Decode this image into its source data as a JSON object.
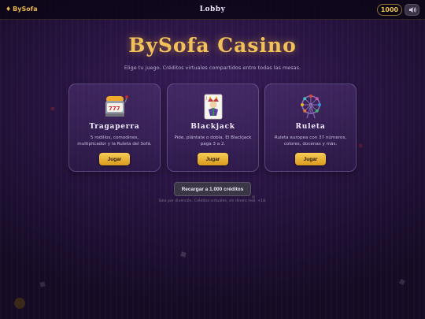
{
  "topbar": {
    "brand": "BySofa",
    "brand_icon": "diamond-icon",
    "nav_lobby": "Lobby",
    "credits": "1000",
    "sound_icon": "speaker-icon"
  },
  "main": {
    "title": "BySofa Casino",
    "subtitle": "Elige tu juego. Créditos virtuales compartidos entre todas las mesas."
  },
  "games": [
    {
      "icon": "slot-machine-icon",
      "name": "Tragaperra",
      "desc": "5 rodillos, comodines, multiplicador y la Ruleta del Sofá.",
      "button": "Jugar"
    },
    {
      "icon": "joker-card-icon",
      "name": "Blackjack",
      "desc": "Pide, plántate o dobla. El Blackjack paga 3 a 2.",
      "button": "Jugar"
    },
    {
      "icon": "ferris-wheel-icon",
      "name": "Ruleta",
      "desc": "Ruleta europea con 37 números, colores, docenas y más.",
      "button": "Jugar"
    }
  ],
  "recharge_button": "Recargar a 1.000 créditos",
  "footnote": "Solo por diversión. Créditos virtuales, sin dinero real. +18.",
  "colors": {
    "accent_gold": "#f2c15a",
    "background": "#1e1030",
    "card": "#3f2a62"
  }
}
